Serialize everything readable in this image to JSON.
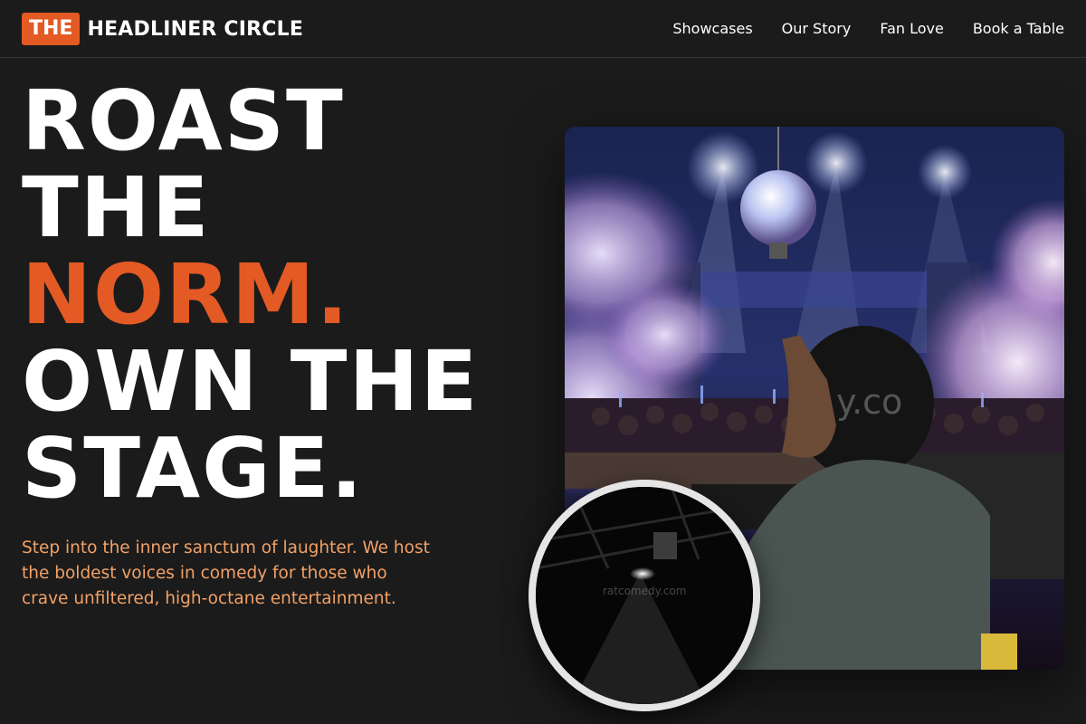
{
  "header": {
    "logo_badge": "THE",
    "logo_text": "HEADLINER CIRCLE",
    "nav": [
      "Showcases",
      "Our Story",
      "Fan Love",
      "Book a Table"
    ]
  },
  "hero": {
    "title_lines": [
      "ROAST",
      "THE",
      "NORM.",
      "OWN THE",
      "STAGE."
    ],
    "description": "Step into the inner sanctum of laughter. We host the boldest voices in comedy for those who crave unfiltered, high-octane entertainment."
  },
  "media": {
    "main_watermark": "y.co",
    "circle_watermark": "ratcomedy.com"
  },
  "colors": {
    "background": "#1b1b1b",
    "accent": "#e35a24",
    "description": "#f2a167",
    "text": "#ffffff"
  }
}
